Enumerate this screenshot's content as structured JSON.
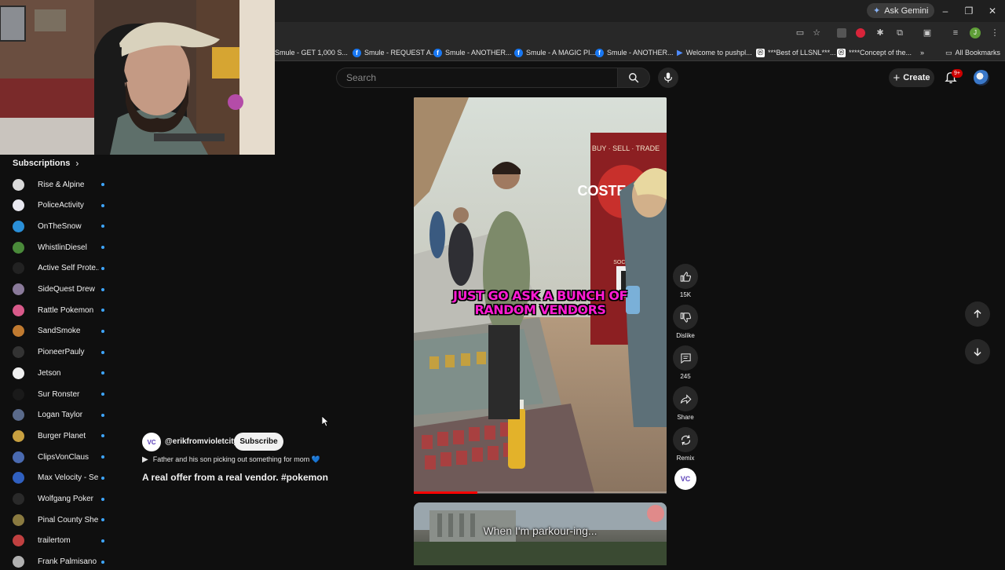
{
  "browser": {
    "gemini_label": "Ask Gemini",
    "profile_initial": "J",
    "bookmarks": [
      {
        "label": "Smule - GET 1,000 S...",
        "icon": "facebook-icon"
      },
      {
        "label": "Smule - REQUEST A...",
        "icon": "facebook-icon"
      },
      {
        "label": "Smule - ANOTHER...",
        "icon": "facebook-icon"
      },
      {
        "label": "Smule - A MAGIC PI...",
        "icon": "facebook-icon"
      },
      {
        "label": "Smule - ANOTHER...",
        "icon": "facebook-icon"
      },
      {
        "label": "Welcome to pushpl...",
        "icon": "pushpl-icon"
      },
      {
        "label": "***Best of LLSNL***...",
        "icon": "doc-icon"
      },
      {
        "label": "****Concept of the...",
        "icon": "doc-icon"
      }
    ],
    "all_bookmarks_label": "All Bookmarks"
  },
  "header": {
    "search_placeholder": "Search",
    "create_label": "Create",
    "notification_badge": "9+"
  },
  "sidebar": {
    "heading": "Subscriptions",
    "items": [
      {
        "label": "Rise & Alpine",
        "color": "#d9d9d9"
      },
      {
        "label": "PoliceActivity",
        "color": "#e8e8f0"
      },
      {
        "label": "OnTheSnow",
        "color": "#2a8fd8"
      },
      {
        "label": "WhistlinDiesel",
        "color": "#4a8a3a"
      },
      {
        "label": "Active Self Prote...",
        "color": "#222222"
      },
      {
        "label": "SideQuest Drew",
        "color": "#8a7a9a"
      },
      {
        "label": "Rattle Pokemon",
        "color": "#d85a8a"
      },
      {
        "label": "SandSmoke",
        "color": "#c07a30"
      },
      {
        "label": "PioneerPauly",
        "color": "#333333"
      },
      {
        "label": "Jetson",
        "color": "#f0f0f0"
      },
      {
        "label": "Sur Ronster",
        "color": "#1a1a1a"
      },
      {
        "label": "Logan Taylor",
        "color": "#5a6a8a"
      },
      {
        "label": "Burger Planet",
        "color": "#c8a040"
      },
      {
        "label": "ClipsVonClaus",
        "color": "#4a6ab0"
      },
      {
        "label": "Max Velocity - Se...",
        "color": "#3060c0"
      },
      {
        "label": "Wolfgang Poker",
        "color": "#2a2a2a"
      },
      {
        "label": "Pinal County She...",
        "color": "#8a7a40"
      },
      {
        "label": "trailertom",
        "color": "#c04040"
      },
      {
        "label": "Frank Palmisano",
        "color": "#b0b0b0"
      }
    ]
  },
  "short": {
    "caption_line1": "JUST GO ASK A BUNCH OF",
    "caption_line2": "RANDOM VENDORS",
    "booth_sign_top": "BUY · SELL · TRADE",
    "booth_sign_main": "COSTE CARD",
    "booth_sign_sub": "SOCIAL LINKS",
    "progress": 0.25,
    "next_caption": "When I'm parkour-ing..."
  },
  "actions": {
    "likes": "15K",
    "dislike_label": "Dislike",
    "comments": "245",
    "share_label": "Share",
    "remix_label": "Remix"
  },
  "meta": {
    "channel_handle": "@erikfromvioletcity",
    "channel_logo_text": "VC",
    "subscribe_label": "Subscribe",
    "audio_text": "Father and his son picking out something for mom 💙",
    "title": "A real offer from a real vendor.  #pokemon"
  }
}
